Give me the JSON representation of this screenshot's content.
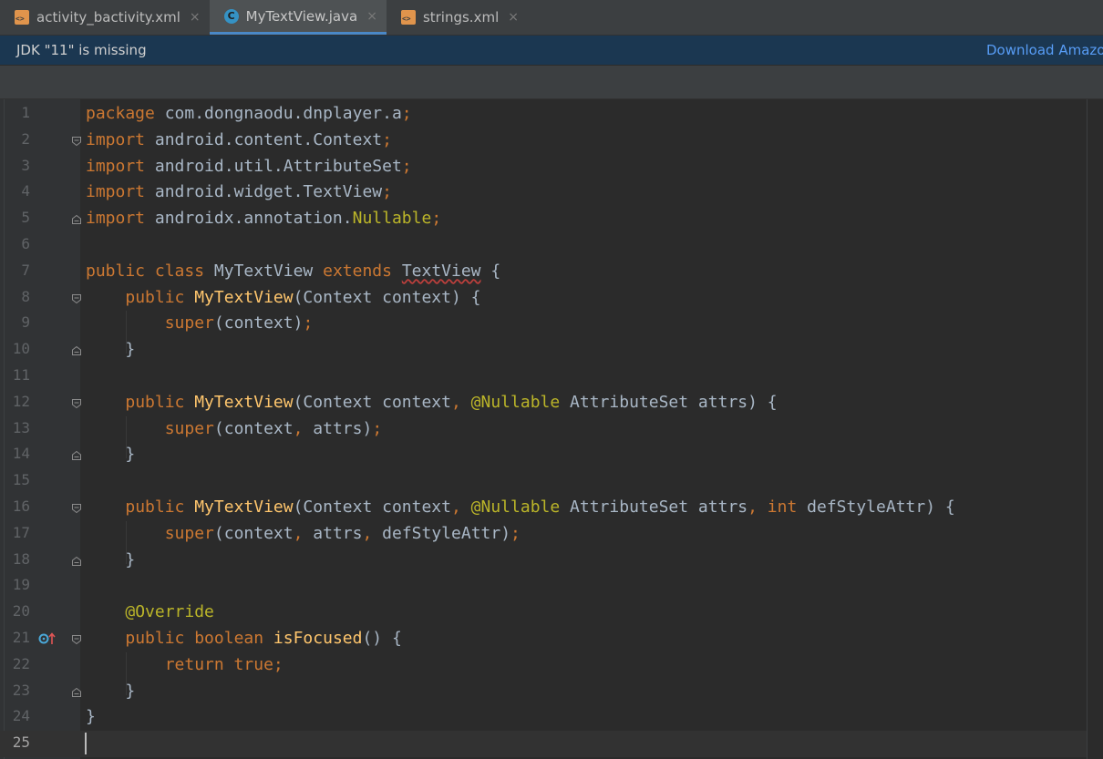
{
  "tabs": [
    {
      "label": "activity_bactivity.xml",
      "icon": "xml-file-icon",
      "active": false
    },
    {
      "label": "MyTextView.java",
      "icon": "java-class-icon",
      "active": true
    },
    {
      "label": "strings.xml",
      "icon": "xml-file-icon",
      "active": false
    }
  ],
  "tab_close_glyph": "×",
  "banner": {
    "message": "JDK \"11\" is missing",
    "link": "Download Amazo"
  },
  "editor": {
    "current_line": 25,
    "lines": [
      {
        "num": "1",
        "tokens": [
          [
            "k",
            "package"
          ],
          [
            "n",
            " com.dongnaodu.dnplayer.a"
          ],
          [
            "k",
            ";"
          ]
        ]
      },
      {
        "num": "2",
        "tokens": [
          [
            "k",
            "import"
          ],
          [
            "n",
            " android.content.Context"
          ],
          [
            "k",
            ";"
          ]
        ]
      },
      {
        "num": "3",
        "tokens": [
          [
            "k",
            "import"
          ],
          [
            "n",
            " android.util.AttributeSet"
          ],
          [
            "k",
            ";"
          ]
        ]
      },
      {
        "num": "4",
        "tokens": [
          [
            "k",
            "import"
          ],
          [
            "n",
            " android.widget.TextView"
          ],
          [
            "k",
            ";"
          ]
        ]
      },
      {
        "num": "5",
        "tokens": [
          [
            "k",
            "import"
          ],
          [
            "n",
            " androidx.annotation."
          ],
          [
            "nul",
            "Nullable"
          ],
          [
            "k",
            ";"
          ]
        ]
      },
      {
        "num": "6",
        "tokens": []
      },
      {
        "num": "7",
        "tokens": [
          [
            "k",
            "public class "
          ],
          [
            "n",
            "MyTextView "
          ],
          [
            "k",
            "extends "
          ],
          [
            "squig",
            "TextView"
          ],
          [
            "n",
            " {"
          ]
        ]
      },
      {
        "num": "8",
        "tokens": [
          [
            "n",
            "    "
          ],
          [
            "k",
            "public "
          ],
          [
            "f",
            "MyTextView"
          ],
          [
            "n",
            "(Context context) {"
          ]
        ]
      },
      {
        "num": "9",
        "tokens": [
          [
            "n",
            "        "
          ],
          [
            "k",
            "super"
          ],
          [
            "n",
            "(context)"
          ],
          [
            "k",
            ";"
          ]
        ]
      },
      {
        "num": "10",
        "tokens": [
          [
            "n",
            "    }"
          ]
        ]
      },
      {
        "num": "11",
        "tokens": []
      },
      {
        "num": "12",
        "tokens": [
          [
            "n",
            "    "
          ],
          [
            "k",
            "public "
          ],
          [
            "f",
            "MyTextView"
          ],
          [
            "n",
            "(Context context"
          ],
          [
            "k",
            ", "
          ],
          [
            "a",
            "@Nullable "
          ],
          [
            "n",
            "AttributeSet attrs) {"
          ]
        ]
      },
      {
        "num": "13",
        "tokens": [
          [
            "n",
            "        "
          ],
          [
            "k",
            "super"
          ],
          [
            "n",
            "(context"
          ],
          [
            "k",
            ", "
          ],
          [
            "n",
            "attrs)"
          ],
          [
            "k",
            ";"
          ]
        ]
      },
      {
        "num": "14",
        "tokens": [
          [
            "n",
            "    }"
          ]
        ]
      },
      {
        "num": "15",
        "tokens": []
      },
      {
        "num": "16",
        "tokens": [
          [
            "n",
            "    "
          ],
          [
            "k",
            "public "
          ],
          [
            "f",
            "MyTextView"
          ],
          [
            "n",
            "(Context context"
          ],
          [
            "k",
            ", "
          ],
          [
            "a",
            "@Nullable "
          ],
          [
            "n",
            "AttributeSet attrs"
          ],
          [
            "k",
            ", int "
          ],
          [
            "n",
            "defStyleAttr) {"
          ]
        ]
      },
      {
        "num": "17",
        "tokens": [
          [
            "n",
            "        "
          ],
          [
            "k",
            "super"
          ],
          [
            "n",
            "(context"
          ],
          [
            "k",
            ", "
          ],
          [
            "n",
            "attrs"
          ],
          [
            "k",
            ", "
          ],
          [
            "n",
            "defStyleAttr)"
          ],
          [
            "k",
            ";"
          ]
        ]
      },
      {
        "num": "18",
        "tokens": [
          [
            "n",
            "    }"
          ]
        ]
      },
      {
        "num": "19",
        "tokens": []
      },
      {
        "num": "20",
        "tokens": [
          [
            "n",
            "    "
          ],
          [
            "a",
            "@Override"
          ]
        ]
      },
      {
        "num": "21",
        "tokens": [
          [
            "n",
            "    "
          ],
          [
            "k",
            "public boolean "
          ],
          [
            "f",
            "isFocused"
          ],
          [
            "n",
            "() {"
          ]
        ]
      },
      {
        "num": "22",
        "tokens": [
          [
            "n",
            "        "
          ],
          [
            "k",
            "return true;"
          ]
        ]
      },
      {
        "num": "23",
        "tokens": [
          [
            "n",
            "    }"
          ]
        ]
      },
      {
        "num": "24",
        "tokens": [
          [
            "n",
            "}"
          ]
        ]
      },
      {
        "num": "25",
        "tokens": []
      }
    ],
    "fold_markers": [
      {
        "line": 2,
        "kind": "open"
      },
      {
        "line": 5,
        "kind": "close"
      },
      {
        "line": 8,
        "kind": "open"
      },
      {
        "line": 10,
        "kind": "close"
      },
      {
        "line": 12,
        "kind": "open"
      },
      {
        "line": 14,
        "kind": "close"
      },
      {
        "line": 16,
        "kind": "open"
      },
      {
        "line": 18,
        "kind": "close"
      },
      {
        "line": 21,
        "kind": "open"
      },
      {
        "line": 23,
        "kind": "close"
      }
    ],
    "override_gutter_icon": {
      "line": 21,
      "icon": "overrides-method-icon"
    }
  },
  "colors": {
    "keyword": "#cc7832",
    "method": "#ffc66d",
    "annotation": "#bbb529",
    "text": "#a9b7c6",
    "banner_bg": "#1b3751",
    "link": "#589df6"
  }
}
